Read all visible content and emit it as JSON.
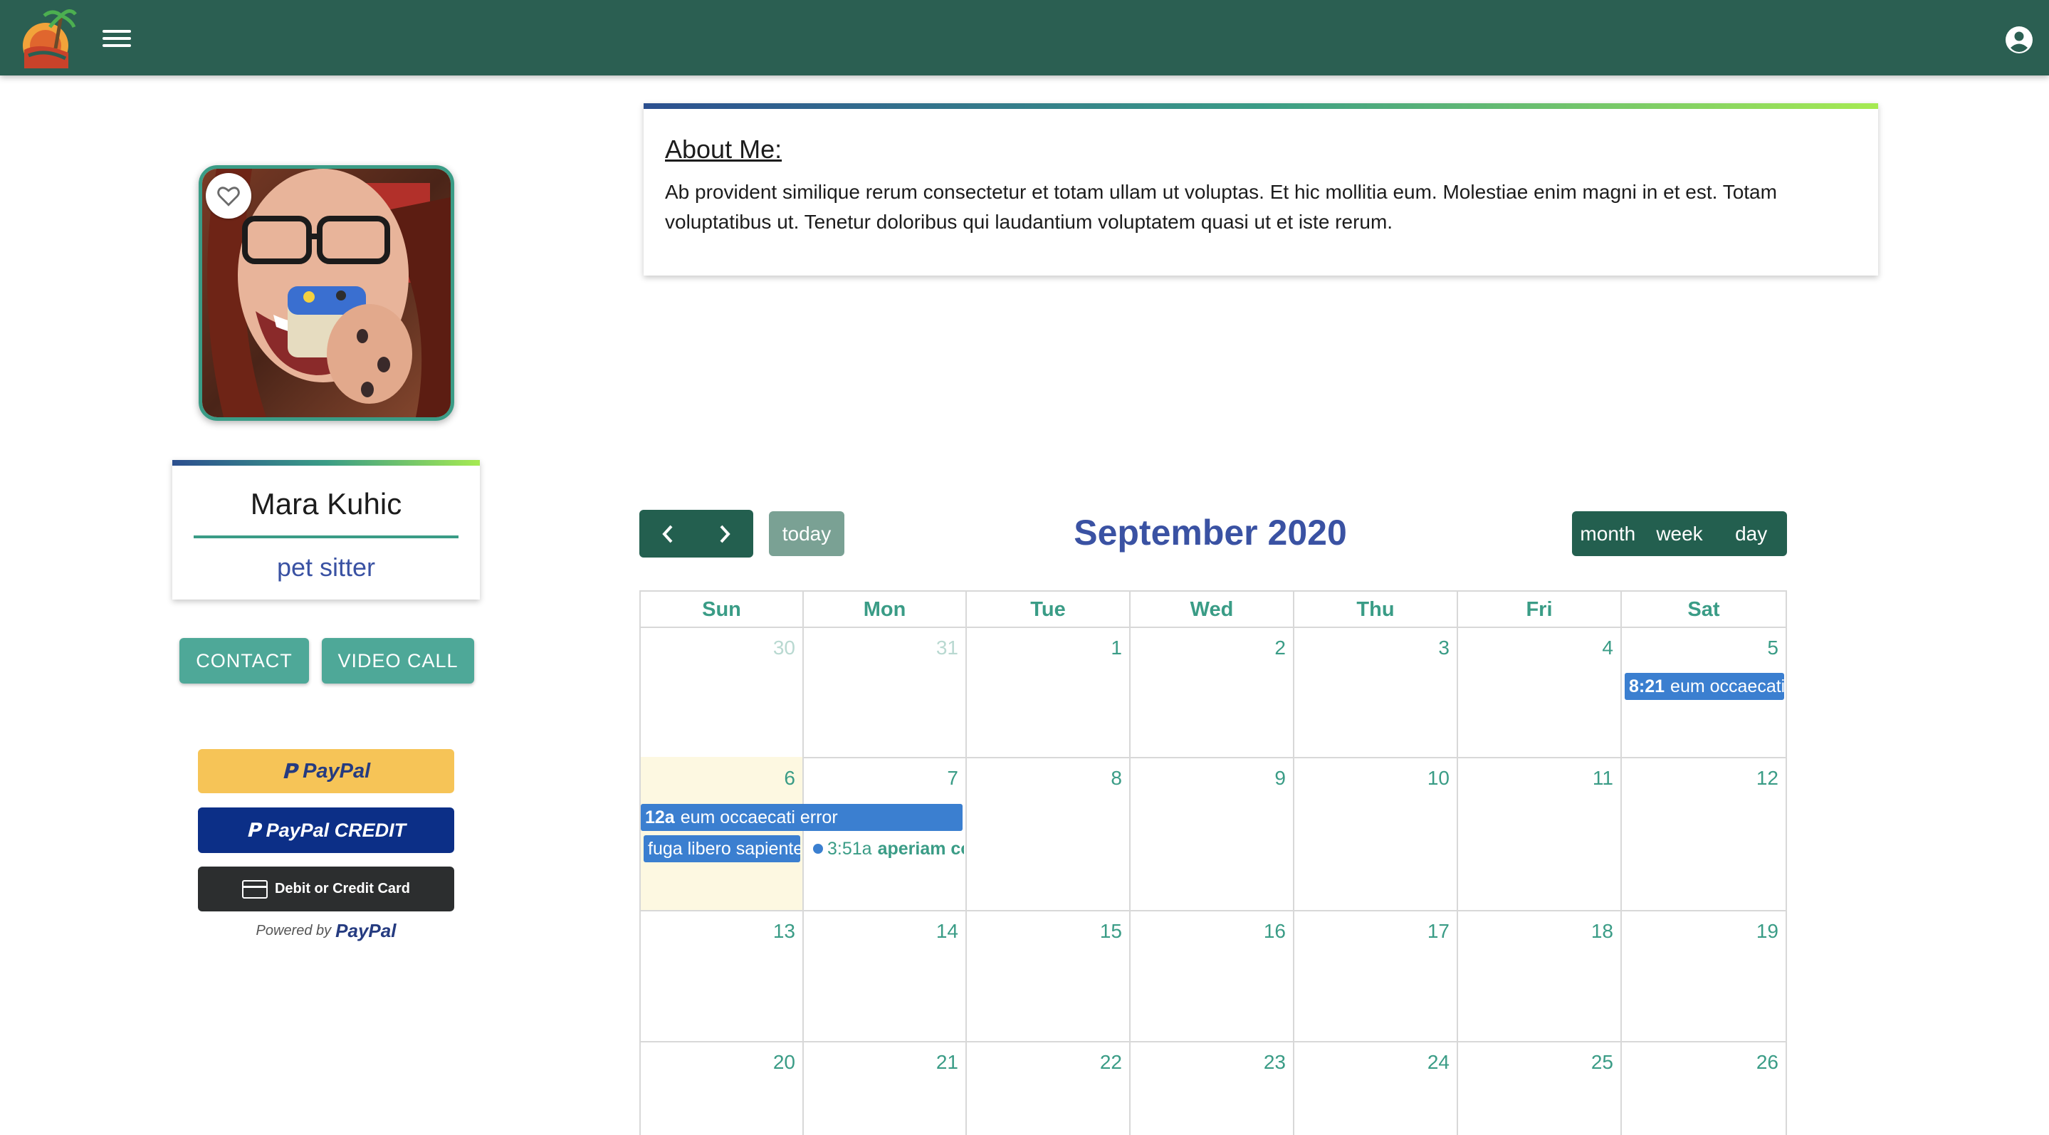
{
  "colors": {
    "topbar": "#2b5f52",
    "accent": "#3a9c86",
    "title_blue": "#3a52a3",
    "event_blue": "#3b7fd0",
    "today_bg": "#fdf8e1",
    "paypal_gold": "#f6c457",
    "paypal_navy": "#0c2f87"
  },
  "topbar": {
    "logo_icon": "palm-tree-sunset-logo",
    "menu_icon": "hamburger-menu-icon",
    "account_icon": "account-circle-icon"
  },
  "profile": {
    "name": "Mara Kuhic",
    "role": "pet sitter",
    "favorite_icon": "heart-outline-icon"
  },
  "actions": {
    "contact": "CONTACT",
    "video_call": "VIDEO CALL"
  },
  "payment": {
    "paypal": "PayPal",
    "paypal_credit": "PayPal CREDIT",
    "card": "Debit or Credit Card",
    "powered_prefix": "Powered by",
    "powered_brand": "PayPal"
  },
  "about": {
    "title": "About Me:",
    "text": "Ab provident similique rerum consectetur et totam ullam ut voluptas. Et hic mollitia eum. Molestiae enim magni in et est. Totam voluptatibus ut. Tenetur doloribus qui laudantium voluptatem quasi ut et iste rerum."
  },
  "calendar": {
    "title": "September 2020",
    "today_label": "today",
    "prev_icon": "chevron-left-icon",
    "next_icon": "chevron-right-icon",
    "views": [
      "month",
      "week",
      "day"
    ],
    "weekdays": [
      "Sun",
      "Mon",
      "Tue",
      "Wed",
      "Thu",
      "Fri",
      "Sat"
    ],
    "weeks": [
      [
        "30",
        "31",
        "1",
        "2",
        "3",
        "4",
        "5"
      ],
      [
        "6",
        "7",
        "8",
        "9",
        "10",
        "11",
        "12"
      ],
      [
        "13",
        "14",
        "15",
        "16",
        "17",
        "18",
        "19"
      ],
      [
        "20",
        "21",
        "22",
        "23",
        "24",
        "25",
        "26"
      ]
    ],
    "events": {
      "sat5": {
        "time": "8:21",
        "title": "eum occaecati"
      },
      "allday": {
        "time": "12a",
        "title": "eum occaecati error"
      },
      "sun6": {
        "title": "fuga libero sapiente"
      },
      "mon7": {
        "time": "3:51a",
        "title": "aperiam corrupti"
      }
    }
  }
}
